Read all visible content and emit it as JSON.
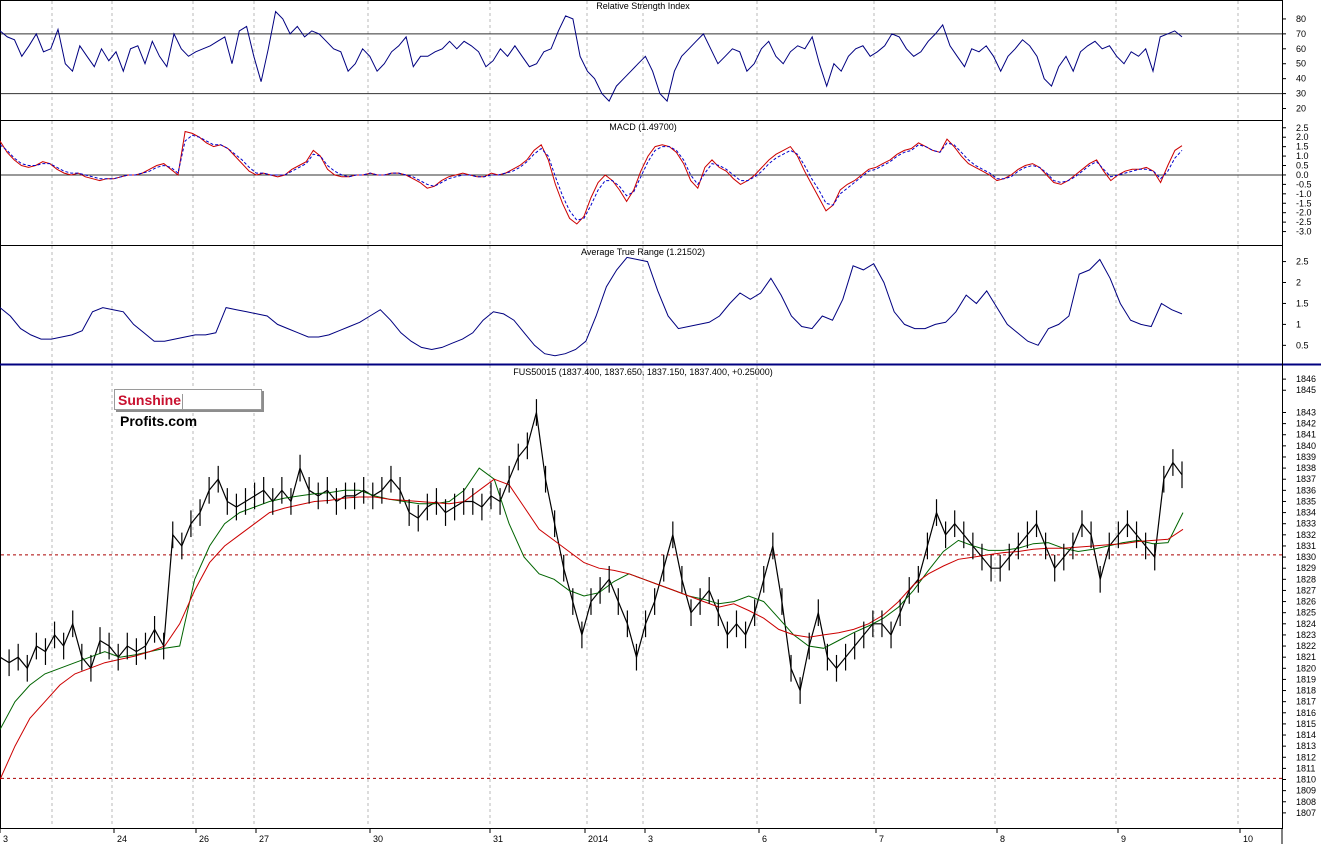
{
  "chart_data": [
    {
      "type": "line",
      "title": "Relative Strength Index",
      "ylim": [
        15,
        90
      ],
      "yticks": [
        80,
        70,
        60,
        50,
        40,
        30,
        20
      ],
      "reference_lines": [
        70,
        30
      ],
      "series": [
        {
          "color": "#000080",
          "values": [
            72,
            68,
            66,
            55,
            62,
            70,
            58,
            60,
            73,
            50,
            45,
            62,
            55,
            48,
            60,
            52,
            58,
            45,
            60,
            62,
            50,
            65,
            55,
            48,
            70,
            60,
            55,
            58,
            60,
            62,
            65,
            68,
            50,
            72,
            75,
            55,
            38,
            60,
            85,
            80,
            70,
            75,
            68,
            72,
            70,
            65,
            60,
            58,
            45,
            50,
            60,
            55,
            45,
            50,
            58,
            62,
            68,
            48,
            55,
            55,
            58,
            60,
            65,
            60,
            65,
            62,
            58,
            48,
            52,
            60,
            55,
            62,
            55,
            48,
            50,
            58,
            60,
            72,
            82,
            80,
            55,
            45,
            40,
            30,
            25,
            35,
            40,
            45,
            50,
            55,
            45,
            30,
            25,
            45,
            55,
            60,
            65,
            70,
            60,
            50,
            55,
            60,
            58,
            45,
            50,
            60,
            65,
            55,
            50,
            58,
            62,
            60,
            68,
            50,
            35,
            50,
            45,
            55,
            60,
            62,
            55,
            58,
            62,
            70,
            68,
            60,
            55,
            58,
            65,
            70,
            76,
            62,
            55,
            48,
            60,
            58,
            62,
            55,
            45,
            55,
            60,
            66,
            62,
            55,
            40,
            35,
            48,
            55,
            45,
            58,
            62,
            65,
            60,
            62,
            55,
            50,
            58,
            55,
            60,
            45,
            68,
            70,
            72,
            68
          ]
        }
      ]
    },
    {
      "type": "line",
      "title": "MACD (1.49700)",
      "ylim": [
        -3.5,
        2.7
      ],
      "yticks": [
        2.5,
        2.0,
        1.5,
        1.0,
        0.5,
        0.0,
        -0.5,
        -1.0,
        -1.5,
        -2.0,
        -2.5,
        -3.0
      ],
      "reference_lines": [
        0
      ],
      "series": [
        {
          "name": "MACD",
          "color": "#cc0000",
          "values": [
            1.8,
            1.2,
            0.8,
            0.5,
            0.4,
            0.5,
            0.7,
            0.6,
            0.3,
            0.1,
            0.0,
            0.1,
            -0.1,
            -0.2,
            -0.3,
            -0.2,
            -0.2,
            -0.1,
            0.0,
            0.0,
            0.1,
            0.3,
            0.5,
            0.6,
            0.3,
            0.0,
            2.3,
            2.2,
            2.0,
            1.7,
            1.5,
            1.6,
            1.4,
            1.0,
            0.6,
            0.2,
            0.0,
            0.1,
            0.0,
            -0.1,
            0.0,
            0.3,
            0.5,
            0.7,
            1.3,
            1.0,
            0.3,
            0.0,
            -0.1,
            -0.1,
            0.0,
            0.0,
            0.1,
            0.0,
            0.0,
            0.1,
            0.1,
            0.0,
            -0.2,
            -0.4,
            -0.7,
            -0.6,
            -0.3,
            -0.1,
            0.0,
            0.1,
            0.0,
            -0.1,
            -0.1,
            0.1,
            0.0,
            0.1,
            0.3,
            0.5,
            0.8,
            1.3,
            1.6,
            0.8,
            -0.5,
            -1.5,
            -2.3,
            -2.6,
            -2.2,
            -1.2,
            -0.4,
            0.0,
            -0.3,
            -0.8,
            -1.4,
            -0.8,
            0.2,
            1.0,
            1.5,
            1.6,
            1.5,
            1.2,
            0.6,
            -0.3,
            -0.7,
            0.4,
            0.8,
            0.4,
            0.2,
            -0.2,
            -0.5,
            -0.3,
            0.0,
            0.4,
            0.8,
            1.1,
            1.3,
            1.5,
            1.0,
            0.2,
            -0.5,
            -1.2,
            -1.9,
            -1.6,
            -0.8,
            -0.5,
            -0.3,
            0.0,
            0.3,
            0.4,
            0.6,
            0.8,
            1.1,
            1.3,
            1.4,
            1.7,
            1.5,
            1.3,
            1.2,
            1.9,
            1.5,
            1.0,
            0.6,
            0.4,
            0.2,
            0.0,
            -0.3,
            -0.2,
            0.0,
            0.3,
            0.5,
            0.6,
            0.4,
            0.0,
            -0.4,
            -0.5,
            -0.3,
            0.0,
            0.3,
            0.6,
            0.8,
            0.2,
            -0.3,
            0.0,
            0.2,
            0.3,
            0.3,
            0.4,
            0.2,
            -0.4,
            0.5,
            1.3,
            1.55
          ]
        },
        {
          "name": "Signal",
          "color": "#0000cc",
          "values": [
            1.6,
            1.3,
            0.9,
            0.6,
            0.5,
            0.5,
            0.6,
            0.6,
            0.4,
            0.2,
            0.1,
            0.1,
            0.0,
            -0.1,
            -0.2,
            -0.2,
            -0.2,
            -0.1,
            0.0,
            0.0,
            0.1,
            0.2,
            0.4,
            0.5,
            0.4,
            0.1,
            1.8,
            2.1,
            2.0,
            1.8,
            1.6,
            1.6,
            1.4,
            1.1,
            0.8,
            0.4,
            0.1,
            0.1,
            0.0,
            0.0,
            0.0,
            0.2,
            0.4,
            0.6,
            1.1,
            1.0,
            0.5,
            0.2,
            0.0,
            -0.1,
            0.0,
            0.0,
            0.1,
            0.0,
            0.0,
            0.1,
            0.1,
            0.0,
            -0.1,
            -0.3,
            -0.5,
            -0.6,
            -0.4,
            -0.2,
            -0.1,
            0.0,
            0.0,
            -0.1,
            -0.1,
            0.0,
            0.0,
            0.1,
            0.2,
            0.4,
            0.7,
            1.1,
            1.4,
            1.0,
            -0.1,
            -1.1,
            -1.9,
            -2.4,
            -2.3,
            -1.6,
            -0.8,
            -0.3,
            -0.3,
            -0.6,
            -1.1,
            -0.9,
            -0.1,
            0.7,
            1.3,
            1.5,
            1.5,
            1.3,
            0.8,
            0.0,
            -0.5,
            0.1,
            0.6,
            0.5,
            0.3,
            0.0,
            -0.3,
            -0.3,
            -0.1,
            0.2,
            0.6,
            0.9,
            1.1,
            1.3,
            1.1,
            0.5,
            -0.2,
            -0.8,
            -1.5,
            -1.6,
            -1.0,
            -0.7,
            -0.4,
            -0.1,
            0.2,
            0.3,
            0.5,
            0.7,
            1.0,
            1.2,
            1.3,
            1.6,
            1.5,
            1.3,
            1.2,
            1.7,
            1.6,
            1.2,
            0.8,
            0.5,
            0.3,
            0.1,
            -0.2,
            -0.2,
            -0.1,
            0.2,
            0.4,
            0.5,
            0.4,
            0.1,
            -0.3,
            -0.4,
            -0.3,
            -0.1,
            0.2,
            0.5,
            0.7,
            0.3,
            -0.1,
            0.0,
            0.1,
            0.2,
            0.3,
            0.3,
            0.2,
            -0.2,
            0.2,
            0.9,
            1.3
          ]
        }
      ]
    },
    {
      "type": "line",
      "title": "Average True Range (1.21502)",
      "ylim": [
        0.15,
        2.8
      ],
      "yticks": [
        2.5,
        2.0,
        1.5,
        1.0,
        0.5
      ],
      "series": [
        {
          "color": "#000080",
          "values": [
            1.4,
            1.2,
            0.9,
            0.75,
            0.65,
            0.65,
            0.7,
            0.75,
            0.85,
            1.3,
            1.4,
            1.35,
            1.3,
            1.0,
            0.8,
            0.6,
            0.6,
            0.65,
            0.7,
            0.75,
            0.75,
            0.8,
            1.4,
            1.35,
            1.3,
            1.25,
            1.2,
            1.0,
            0.9,
            0.8,
            0.7,
            0.7,
            0.75,
            0.85,
            0.95,
            1.05,
            1.2,
            1.35,
            1.1,
            0.8,
            0.6,
            0.45,
            0.4,
            0.45,
            0.55,
            0.65,
            0.8,
            1.1,
            1.3,
            1.25,
            1.1,
            0.8,
            0.5,
            0.3,
            0.25,
            0.3,
            0.4,
            0.6,
            1.2,
            1.9,
            2.3,
            2.6,
            2.55,
            2.5,
            1.8,
            1.2,
            0.9,
            0.95,
            1.0,
            1.05,
            1.2,
            1.5,
            1.75,
            1.6,
            1.75,
            2.1,
            1.7,
            1.2,
            0.95,
            0.9,
            1.2,
            1.1,
            1.6,
            2.4,
            2.3,
            2.45,
            2.0,
            1.3,
            1.0,
            0.9,
            0.9,
            1.0,
            1.05,
            1.3,
            1.7,
            1.5,
            1.8,
            1.4,
            1.0,
            0.8,
            0.6,
            0.5,
            0.9,
            1.0,
            1.2,
            2.2,
            2.3,
            2.55,
            2.1,
            1.5,
            1.1,
            1.0,
            0.95,
            1.5,
            1.35,
            1.25
          ]
        }
      ]
    },
    {
      "type": "line",
      "title": "FUS50015 (1837.400, 1837.650, 1837.150, 1837.400, +0.25000)",
      "ylim": [
        1806,
        1847
      ],
      "yticks": [
        1846,
        1845,
        1843,
        1842,
        1841,
        1840,
        1839,
        1838,
        1837,
        1836,
        1835,
        1834,
        1833,
        1832,
        1831,
        1830,
        1829,
        1828,
        1827,
        1826,
        1825,
        1824,
        1823,
        1822,
        1821,
        1820,
        1819,
        1818,
        1817,
        1816,
        1815,
        1814,
        1813,
        1812,
        1811,
        1810,
        1809,
        1808,
        1807
      ],
      "reference_lines": [
        1830.2,
        1810.1
      ],
      "x_labels": [
        "3",
        "24",
        "26",
        "27",
        "30",
        "31",
        "2014",
        "3",
        "6",
        "7",
        "8",
        "9",
        "10"
      ],
      "series": [
        {
          "name": "Price",
          "color": "#000000",
          "values": [
            1821,
            1820.5,
            1821,
            1820,
            1822,
            1821.5,
            1823,
            1822,
            1824,
            1821,
            1820,
            1822.5,
            1822,
            1821,
            1822,
            1821.5,
            1822,
            1823.5,
            1822,
            1832,
            1831,
            1833,
            1834,
            1836,
            1837,
            1835,
            1834.5,
            1835,
            1835.5,
            1836,
            1835,
            1836,
            1835,
            1838,
            1836,
            1835.5,
            1836,
            1835,
            1835.5,
            1835.5,
            1836,
            1835.5,
            1836,
            1837,
            1836,
            1834,
            1833.5,
            1834.5,
            1835,
            1834,
            1834.5,
            1835,
            1835,
            1834.5,
            1835.5,
            1835,
            1837,
            1839,
            1840,
            1843,
            1837,
            1833,
            1829,
            1826,
            1823,
            1826,
            1827,
            1828,
            1826,
            1824,
            1821,
            1824,
            1826,
            1829,
            1832,
            1828,
            1825,
            1826,
            1827,
            1825,
            1823,
            1824,
            1823,
            1825,
            1828,
            1831,
            1826,
            1820,
            1818,
            1822,
            1825,
            1821,
            1820,
            1821,
            1822,
            1823,
            1824,
            1824,
            1823,
            1825,
            1827,
            1828,
            1831,
            1834,
            1832,
            1833,
            1832,
            1831,
            1830,
            1829,
            1829,
            1830,
            1831,
            1832,
            1833,
            1831,
            1829,
            1830,
            1831,
            1833,
            1832,
            1828,
            1831,
            1832,
            1833,
            1832,
            1831,
            1830,
            1837,
            1838.5,
            1837.4
          ]
        },
        {
          "name": "MA short",
          "color": "#006400",
          "values": [
            1814.5,
            1817,
            1818.5,
            1819.5,
            1820,
            1820.5,
            1821,
            1821.5,
            1821,
            1821.2,
            1821.5,
            1821.8,
            1822,
            1828,
            1831,
            1833,
            1834,
            1834.5,
            1835,
            1835.3,
            1835.5,
            1835.7,
            1835.8,
            1836,
            1836,
            1835.5,
            1835.2,
            1835,
            1834.8,
            1834.8,
            1835,
            1836,
            1838,
            1837,
            1833,
            1830,
            1828.5,
            1828,
            1827,
            1826.5,
            1826.8,
            1827.8,
            1828.5,
            1828,
            1827.5,
            1827,
            1826.5,
            1826.2,
            1825.8,
            1826,
            1826.5,
            1826,
            1824.5,
            1823,
            1822,
            1821.8,
            1822.5,
            1823.2,
            1823.8,
            1824.5,
            1825.5,
            1827,
            1828.8,
            1830.5,
            1831.5,
            1831,
            1830.6,
            1830.6,
            1830.8,
            1831.2,
            1831.3,
            1830.8,
            1830.5,
            1830.7,
            1831,
            1831.3,
            1831.5,
            1831.2,
            1831.3,
            1834
          ]
        },
        {
          "name": "MA long",
          "color": "#cc0000",
          "values": [
            1810,
            1813,
            1815.5,
            1817,
            1818.5,
            1819.5,
            1820,
            1820.5,
            1820.8,
            1821.1,
            1821.5,
            1822,
            1824,
            1827,
            1829.5,
            1831,
            1832,
            1833,
            1834,
            1834.4,
            1834.7,
            1835,
            1835.1,
            1835.3,
            1835.4,
            1835.4,
            1835.2,
            1835.1,
            1835,
            1834.9,
            1834.8,
            1835,
            1836,
            1837,
            1836.5,
            1834.5,
            1832.5,
            1831.5,
            1830.5,
            1829.5,
            1829,
            1828.8,
            1828.5,
            1828,
            1827.5,
            1827,
            1826.5,
            1826,
            1825.5,
            1825.8,
            1825.2,
            1824.5,
            1823.5,
            1823,
            1822.8,
            1823,
            1823.2,
            1823.5,
            1824,
            1824.8,
            1826,
            1827.5,
            1828.5,
            1829.2,
            1829.8,
            1830,
            1830.2,
            1830.4,
            1830.5,
            1830.7,
            1830.8,
            1830.8,
            1830.9,
            1831,
            1831.1,
            1831.2,
            1831.4,
            1831.5,
            1831.6,
            1832.5
          ]
        }
      ]
    }
  ],
  "logo": {
    "part1": "Sunshine",
    "part2": "Profits.com"
  }
}
